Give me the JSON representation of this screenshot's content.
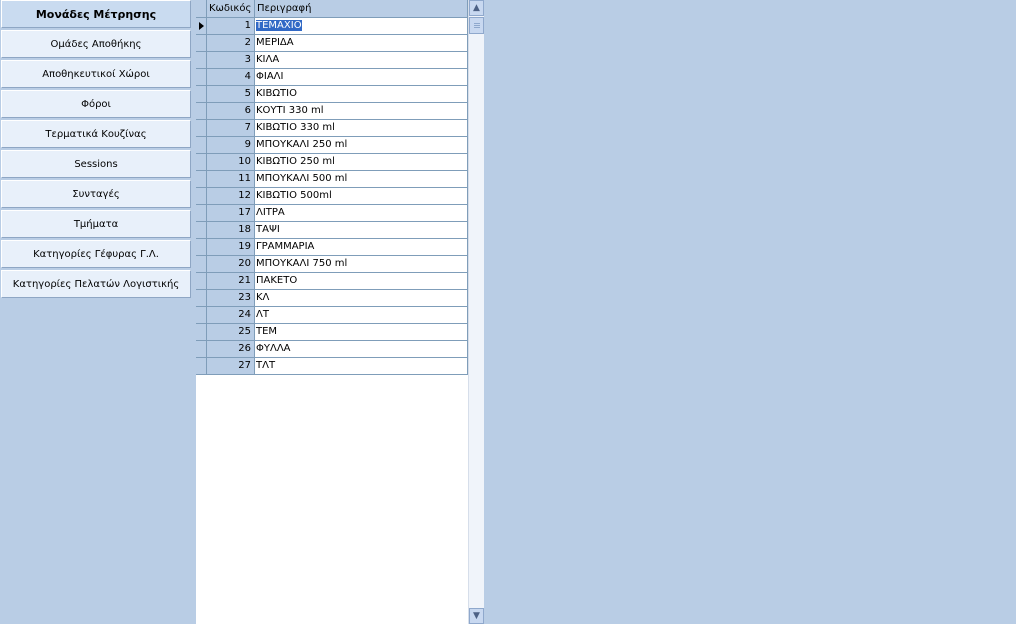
{
  "sidebar": {
    "items": [
      {
        "label": "Μονάδες Μέτρησης",
        "active": true
      },
      {
        "label": "Ομάδες Αποθήκης",
        "active": false
      },
      {
        "label": "Αποθηκευτικοί Χώροι",
        "active": false
      },
      {
        "label": "Φόροι",
        "active": false
      },
      {
        "label": "Τερματικά Κουζίνας",
        "active": false
      },
      {
        "label": "Sessions",
        "active": false
      },
      {
        "label": "Συνταγές",
        "active": false
      },
      {
        "label": "Τμήματα",
        "active": false
      },
      {
        "label": "Κατηγορίες Γέφυρας Γ.Λ.",
        "active": false
      },
      {
        "label": "Κατηγορίες Πελατών Λογιστικής",
        "active": false
      }
    ]
  },
  "grid": {
    "columns": {
      "code": "Κωδικός",
      "description": "Περιγραφή"
    },
    "selected_row": 0,
    "rows": [
      {
        "code": "1",
        "description": "ΤΕΜΑΧΙΟ"
      },
      {
        "code": "2",
        "description": "ΜΕΡΙΔΑ"
      },
      {
        "code": "3",
        "description": "ΚΙΛΑ"
      },
      {
        "code": "4",
        "description": "ΦΙΑΛΙ"
      },
      {
        "code": "5",
        "description": "ΚΙΒΩΤΙΟ"
      },
      {
        "code": "6",
        "description": "ΚΟΥΤΙ 330 ml"
      },
      {
        "code": "7",
        "description": "ΚΙΒΩΤΙΟ 330 ml"
      },
      {
        "code": "9",
        "description": "ΜΠΟΥΚΑΛΙ 250 ml"
      },
      {
        "code": "10",
        "description": "ΚΙΒΩΤΙΟ 250 ml"
      },
      {
        "code": "11",
        "description": "ΜΠΟΥΚΑΛΙ 500 ml"
      },
      {
        "code": "12",
        "description": "ΚΙΒΩΤΙΟ 500ml"
      },
      {
        "code": "17",
        "description": "ΛΙΤΡΑ"
      },
      {
        "code": "18",
        "description": "ΤΑΨΙ"
      },
      {
        "code": "19",
        "description": "ΓΡΑΜΜΑΡΙΑ"
      },
      {
        "code": "20",
        "description": "ΜΠΟΥΚΑΛΙ 750 ml"
      },
      {
        "code": "21",
        "description": "ΠΑΚΕΤΟ"
      },
      {
        "code": "23",
        "description": "ΚΛ"
      },
      {
        "code": "24",
        "description": "ΛΤ"
      },
      {
        "code": "25",
        "description": "ΤΕΜ"
      },
      {
        "code": "26",
        "description": "ΦΥΛΛΑ"
      },
      {
        "code": "27",
        "description": "ΤΛΤ"
      }
    ]
  },
  "scrollbar": {
    "up_icon": "arrow-up-icon",
    "down_icon": "arrow-down-icon"
  },
  "colors": {
    "background": "#b9cde5",
    "selection": "#3169c6"
  }
}
